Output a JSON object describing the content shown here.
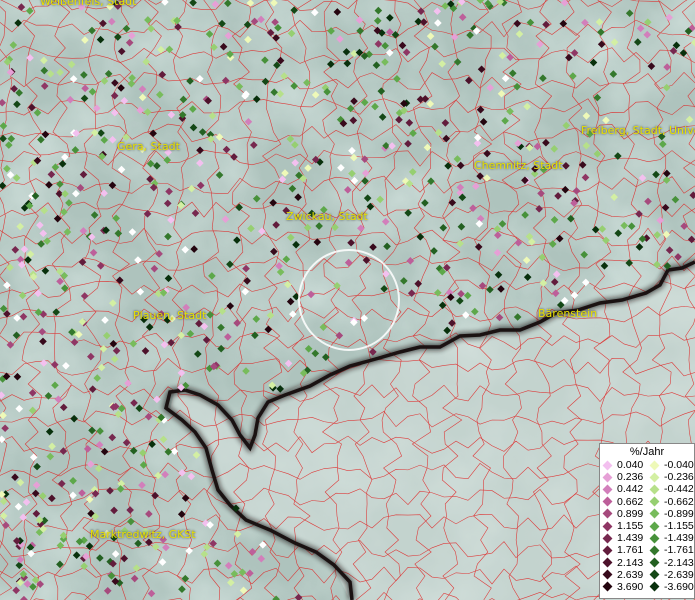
{
  "cities": [
    {
      "name": "Weißenfels, Stadt"
    },
    {
      "name": "Gera, Stadt"
    },
    {
      "name": "Zwickau, Stadt"
    },
    {
      "name": "Chemnitz, Stadt"
    },
    {
      "name": "Freiberg, Stadt, Univers"
    },
    {
      "name": "Plauen, Stadt"
    },
    {
      "name": "Bärenstein"
    },
    {
      "name": "Marktredwitz, GKSt"
    }
  ],
  "legend": {
    "title": "%/Jahr",
    "positive": [
      {
        "label": "0.040",
        "color": "#f3c0ef"
      },
      {
        "label": "0.236",
        "color": "#e6a0d6"
      },
      {
        "label": "0.442",
        "color": "#d27fbb"
      },
      {
        "label": "0.662",
        "color": "#bd5f9a"
      },
      {
        "label": "0.899",
        "color": "#a64a7d"
      },
      {
        "label": "1.155",
        "color": "#8f3664"
      },
      {
        "label": "1.439",
        "color": "#77284f"
      },
      {
        "label": "1.761",
        "color": "#621c3c"
      },
      {
        "label": "2.143",
        "color": "#4d122b"
      },
      {
        "label": "2.639",
        "color": "#380a1c"
      },
      {
        "label": "3.690",
        "color": "#24050f"
      }
    ],
    "negative": [
      {
        "label": "-0.040",
        "color": "#eef9b8"
      },
      {
        "label": "-0.236",
        "color": "#d3efa3"
      },
      {
        "label": "-0.442",
        "color": "#b6e08a"
      },
      {
        "label": "-0.662",
        "color": "#96cf71"
      },
      {
        "label": "-0.899",
        "color": "#78bc5c"
      },
      {
        "label": "-1.155",
        "color": "#5da84a"
      },
      {
        "label": "-1.439",
        "color": "#47913a"
      },
      {
        "label": "-1.761",
        "color": "#34782c"
      },
      {
        "label": "-2.143",
        "color": "#236021"
      },
      {
        "label": "-2.639",
        "color": "#144816"
      },
      {
        "label": "-3.690",
        "color": "#08300c"
      }
    ]
  },
  "colors": {
    "border_red": "#e02020",
    "country_border": "#1a1212",
    "city_label": "#e8e000",
    "terrain": "#b3c8c2"
  }
}
